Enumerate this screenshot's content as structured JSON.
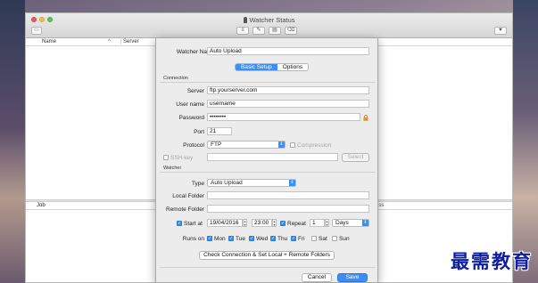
{
  "window": {
    "title": "Watcher Status"
  },
  "table": {
    "col_name": "Name",
    "col_server": "Server",
    "sort_arrow": "^"
  },
  "lower_table": {
    "col_job": "Job",
    "col_progress": "ress"
  },
  "sheet": {
    "watcher_name_label": "Watcher Name",
    "watcher_name_value": "Auto Upload",
    "tabs": {
      "basic": "Basic Setup",
      "options": "Options"
    },
    "connection": {
      "section": "Connection",
      "server_label": "Server",
      "server_value": "ftp.yourserver.com",
      "username_label": "User name",
      "username_value": "username",
      "password_label": "Password",
      "password_value": "••••••••",
      "port_label": "Port",
      "port_value": "21",
      "protocol_label": "Protocol",
      "protocol_value": "FTP",
      "compression_label": "Compression",
      "ssh_key_label": "SSH key",
      "select_button": "Select"
    },
    "watcher": {
      "section": "Watcher",
      "type_label": "Type",
      "type_value": "Auto Upload",
      "local_folder_label": "Local Folder",
      "remote_folder_label": "Remote Folder",
      "start_at_label": "Start at",
      "start_date": "19/04/2016",
      "start_time": "23:00",
      "repeat_label": "Repeat",
      "repeat_value": "1",
      "repeat_unit": "Days",
      "runs_on_label": "Runs on",
      "days": [
        "Mon",
        "Tue",
        "Wed",
        "Thu",
        "Fri",
        "Sat",
        "Sun"
      ],
      "days_checked": [
        true,
        true,
        true,
        true,
        true,
        false,
        false
      ],
      "check_button": "Check Connection & Set Local + Remote Folders"
    },
    "cancel_button": "Cancel",
    "save_button": "Save"
  },
  "watermark": "最需教育",
  "colors": {
    "accent": "#3d8ef2",
    "watermark": "#0d1fa0"
  }
}
